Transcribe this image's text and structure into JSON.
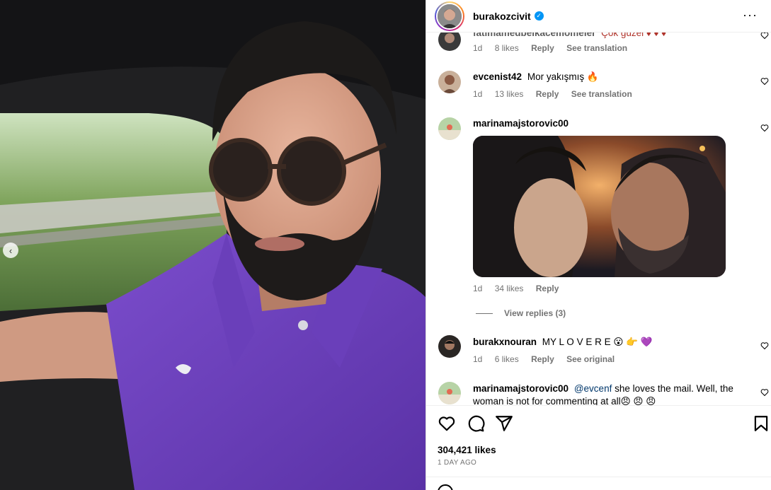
{
  "post": {
    "username": "burakozcivit",
    "likes": "304,421 likes",
    "time": "1 DAY AGO"
  },
  "comments": [
    {
      "user": "fatimamedbelkacemomeler",
      "text": "Çok güzel ♦ ♦ ♦",
      "age": "1d",
      "likes": "8 likes",
      "reply": "Reply",
      "translate": "See translation"
    },
    {
      "user": "evcenist42",
      "text": "Mor yakışmış 🔥",
      "age": "1d",
      "likes": "13 likes",
      "reply": "Reply",
      "translate": "See translation"
    },
    {
      "user": "marinamajstorovic00",
      "text": "",
      "age": "1d",
      "likes": "34 likes",
      "reply": "Reply",
      "view_replies": "View replies (3)"
    },
    {
      "user": "burakxnouran",
      "text": "MY L O V E R E 😮 👉 💜",
      "age": "1d",
      "likes": "6 likes",
      "reply": "Reply",
      "translate": "See original"
    },
    {
      "user": "marinamajstorovic00",
      "mention": "@evcenf",
      "text": " she loves the mail. Well, the woman is not for commenting at all😠 😠 😠"
    }
  ],
  "icons": {
    "verified": "verified-badge-icon",
    "more": "more-options-icon",
    "like": "heart-icon",
    "comment": "comment-icon",
    "share": "share-icon",
    "save": "bookmark-icon",
    "prev": "chevron-left-icon"
  },
  "colors": {
    "shirt": "#6b3fb8",
    "accent": "#0095f6",
    "meta": "#737373"
  }
}
